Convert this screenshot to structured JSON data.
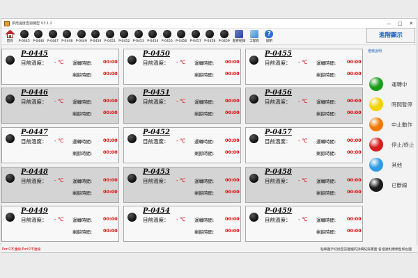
{
  "window": {
    "title": "烘焙溫度查詢機型 V3.1.2",
    "controls": {
      "minimize": "—",
      "maximize": "□",
      "close": "✕"
    }
  },
  "toolbar": {
    "home_label": "首頁",
    "units": [
      "P-0445",
      "P-0446",
      "P-0447",
      "P-0448",
      "P-0449",
      "P-0450",
      "P-0451",
      "P-0452",
      "P-0453",
      "P-0454",
      "P-0455",
      "P-0456",
      "P-0457",
      "P-0458",
      "P-0459"
    ],
    "history_label": "歷史紀錄",
    "engineer_label": "工程頁",
    "help_label": "說明"
  },
  "cards": [
    {
      "id": "P-0445",
      "temp_label": "目前溫度：",
      "temp_value": "- ℃",
      "run_label": "運轉時間:",
      "run_value": "00:00",
      "remain_label": "剩餘時間:",
      "remain_value": "00:00"
    },
    {
      "id": "P-0450",
      "temp_label": "目前溫度：",
      "temp_value": "- ℃",
      "run_label": "運轉時間:",
      "run_value": "00:00",
      "remain_label": "剩餘時間:",
      "remain_value": "00:00"
    },
    {
      "id": "P-0455",
      "temp_label": "目前溫度：",
      "temp_value": "- ℃",
      "run_label": "運轉時間:",
      "run_value": "00:00",
      "remain_label": "剩餘時間:",
      "remain_value": "00:00"
    },
    {
      "id": "P-0446",
      "temp_label": "目前溫度：",
      "temp_value": "- ℃",
      "run_label": "運轉時間:",
      "run_value": "00:00",
      "remain_label": "剩餘時間:",
      "remain_value": "00:00"
    },
    {
      "id": "P-0451",
      "temp_label": "目前溫度：",
      "temp_value": "- ℃",
      "run_label": "運轉時間:",
      "run_value": "00:00",
      "remain_label": "剩餘時間:",
      "remain_value": "00:00"
    },
    {
      "id": "P-0456",
      "temp_label": "目前溫度：",
      "temp_value": "- ℃",
      "run_label": "運轉時間:",
      "run_value": "00:00",
      "remain_label": "剩餘時間:",
      "remain_value": "00:00"
    },
    {
      "id": "P-0447",
      "temp_label": "目前溫度：",
      "temp_value": "- ℃",
      "run_label": "運轉時間:",
      "run_value": "00:00",
      "remain_label": "剩餘時間:",
      "remain_value": "00:00"
    },
    {
      "id": "P-0452",
      "temp_label": "目前溫度：",
      "temp_value": "- ℃",
      "run_label": "運轉時間:",
      "run_value": "00:00",
      "remain_label": "剩餘時間:",
      "remain_value": "00:00"
    },
    {
      "id": "P-0457",
      "temp_label": "目前溫度：",
      "temp_value": "- ℃",
      "run_label": "運轉時間:",
      "run_value": "00:00",
      "remain_label": "剩餘時間:",
      "remain_value": "00:00"
    },
    {
      "id": "P-0448",
      "temp_label": "目前溫度：",
      "temp_value": "- ℃",
      "run_label": "運轉時間:",
      "run_value": "00:00",
      "remain_label": "剩餘時間:",
      "remain_value": "00:00"
    },
    {
      "id": "P-0453",
      "temp_label": "目前溫度：",
      "temp_value": "- ℃",
      "run_label": "運轉時間:",
      "run_value": "00:00",
      "remain_label": "剩餘時間:",
      "remain_value": "00:00"
    },
    {
      "id": "P-0458",
      "temp_label": "目前溫度：",
      "temp_value": "- ℃",
      "run_label": "運轉時間:",
      "run_value": "00:00",
      "remain_label": "剩餘時間:",
      "remain_value": "00:00"
    },
    {
      "id": "P-0449",
      "temp_label": "目前溫度：",
      "temp_value": "- ℃",
      "run_label": "運轉時間:",
      "run_value": "00:00",
      "remain_label": "剩餘時間:",
      "remain_value": "00:00"
    },
    {
      "id": "P-0454",
      "temp_label": "目前溫度：",
      "temp_value": "- ℃",
      "run_label": "運轉時間:",
      "run_value": "00:00",
      "remain_label": "剩餘時間:",
      "remain_value": "00:00"
    },
    {
      "id": "P-0459",
      "temp_label": "目前溫度：",
      "temp_value": "- ℃",
      "run_label": "運轉時間:",
      "run_value": "00:00",
      "remain_label": "剩餘時間:",
      "remain_value": "00:00"
    }
  ],
  "side": {
    "advanced_button": "進階顯示",
    "legend_title": "燈號說明",
    "legend": [
      {
        "label": "運轉中",
        "color": "#1a9e1a"
      },
      {
        "label": "時間暫停",
        "color": "#f2d200"
      },
      {
        "label": "中止動作",
        "color": "#f07800"
      },
      {
        "label": "停止/終止",
        "color": "#d61c1c"
      },
      {
        "label": "其他",
        "color": "#2e9be6"
      },
      {
        "label": "已斷線",
        "color": "#1a1a1a"
      }
    ]
  },
  "status": {
    "ports": "Port1不連線   Port2不連線",
    "hint": "點擊圖示切換至該圖爐的詳細紀錄畫面 各燈號對應類型如右圖"
  }
}
